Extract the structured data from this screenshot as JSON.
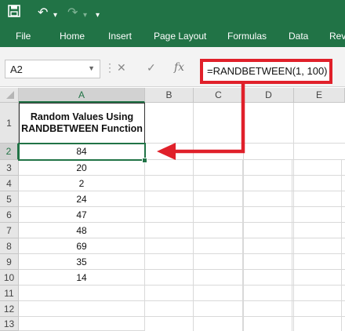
{
  "toolbar": {
    "save_icon": "save-icon",
    "undo_icon": "undo-icon",
    "redo_icon": "redo-icon"
  },
  "ribbon_tabs": [
    "File",
    "Home",
    "Insert",
    "Page Layout",
    "Formulas",
    "Data",
    "Rev"
  ],
  "formula_bar": {
    "name_box": "A2",
    "cancel": "✕",
    "enter": "✓",
    "fx": "fx",
    "formula": "=RANDBETWEEN(1, 100)"
  },
  "columns": [
    "A",
    "B",
    "C",
    "D",
    "E"
  ],
  "rows": [
    "1",
    "2",
    "3",
    "4",
    "5",
    "6",
    "7",
    "8",
    "9",
    "10",
    "11",
    "12",
    "13"
  ],
  "header_cell": "Random Values Using RANDBETWEEN Function",
  "values": [
    "84",
    "20",
    "2",
    "24",
    "47",
    "48",
    "69",
    "35",
    "14"
  ],
  "active_cell": "A2",
  "colors": {
    "accent": "#217346",
    "highlight": "#e0202a"
  }
}
